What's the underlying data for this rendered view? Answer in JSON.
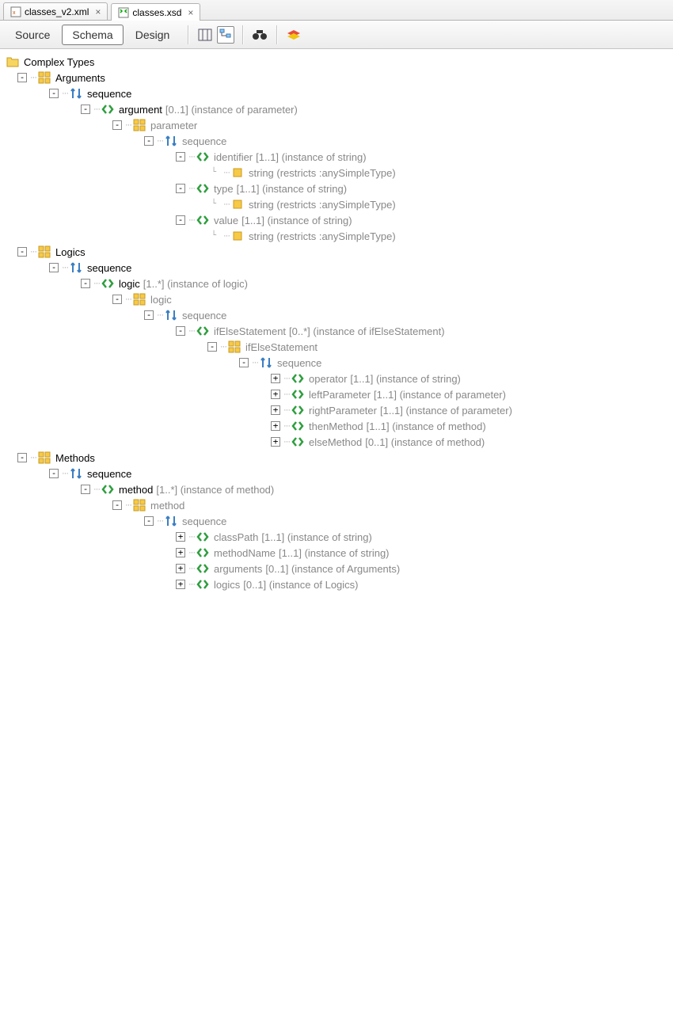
{
  "tabs": [
    {
      "label": "classes_v2.xml",
      "active": false
    },
    {
      "label": "classes.xsd",
      "active": true
    }
  ],
  "modes": [
    {
      "label": "Source",
      "active": false
    },
    {
      "label": "Schema",
      "active": true
    },
    {
      "label": "Design",
      "active": false
    }
  ],
  "root": {
    "label": "Complex Types"
  },
  "tree": [
    {
      "depth": 0,
      "exp": "-",
      "icon": "complex-type",
      "label": "Arguments",
      "bold": true
    },
    {
      "depth": 1,
      "exp": "-",
      "icon": "sequence",
      "label": "sequence",
      "bold": true
    },
    {
      "depth": 2,
      "exp": "-",
      "icon": "element",
      "label": "argument",
      "bold": true,
      "details": " [0..1] (instance of parameter)"
    },
    {
      "depth": 3,
      "exp": "-",
      "icon": "complex-type",
      "label": "parameter",
      "gray": true
    },
    {
      "depth": 4,
      "exp": "-",
      "icon": "sequence",
      "label": "sequence",
      "gray": true
    },
    {
      "depth": 5,
      "exp": "-",
      "icon": "element",
      "label": "identifier",
      "gray": true,
      "details": " [1..1] (instance of string)"
    },
    {
      "depth": 6,
      "exp": "",
      "icon": "simple-type",
      "label": "string (restricts :anySimpleType)",
      "gray": true,
      "last": true
    },
    {
      "depth": 5,
      "exp": "-",
      "icon": "element",
      "label": "type",
      "gray": true,
      "details": " [1..1] (instance of string)"
    },
    {
      "depth": 6,
      "exp": "",
      "icon": "simple-type",
      "label": "string (restricts :anySimpleType)",
      "gray": true,
      "last": true
    },
    {
      "depth": 5,
      "exp": "-",
      "icon": "element",
      "label": "value",
      "gray": true,
      "details": " [1..1] (instance of string)"
    },
    {
      "depth": 6,
      "exp": "",
      "icon": "simple-type",
      "label": "string (restricts :anySimpleType)",
      "gray": true,
      "last": true
    },
    {
      "depth": 0,
      "exp": "-",
      "icon": "complex-type",
      "label": "Logics",
      "bold": true
    },
    {
      "depth": 1,
      "exp": "-",
      "icon": "sequence",
      "label": "sequence",
      "bold": true
    },
    {
      "depth": 2,
      "exp": "-",
      "icon": "element",
      "label": "logic",
      "bold": true,
      "details": " [1..*] (instance of logic)"
    },
    {
      "depth": 3,
      "exp": "-",
      "icon": "complex-type",
      "label": "logic",
      "gray": true
    },
    {
      "depth": 4,
      "exp": "-",
      "icon": "sequence",
      "label": "sequence",
      "gray": true
    },
    {
      "depth": 5,
      "exp": "-",
      "icon": "element",
      "label": "ifElseStatement",
      "gray": true,
      "details": " [0..*] (instance of ifElseStatement)"
    },
    {
      "depth": 6,
      "exp": "-",
      "icon": "complex-type",
      "label": "ifElseStatement",
      "gray": true
    },
    {
      "depth": 7,
      "exp": "-",
      "icon": "sequence",
      "label": "sequence",
      "gray": true
    },
    {
      "depth": 8,
      "exp": "+",
      "icon": "element",
      "label": "operator",
      "gray": true,
      "details": " [1..1] (instance of string)"
    },
    {
      "depth": 8,
      "exp": "+",
      "icon": "element",
      "label": "leftParameter",
      "gray": true,
      "details": " [1..1] (instance of parameter)"
    },
    {
      "depth": 8,
      "exp": "+",
      "icon": "element",
      "label": "rightParameter",
      "gray": true,
      "details": " [1..1] (instance of parameter)"
    },
    {
      "depth": 8,
      "exp": "+",
      "icon": "element",
      "label": "thenMethod",
      "gray": true,
      "details": " [1..1] (instance of method)"
    },
    {
      "depth": 8,
      "exp": "+",
      "icon": "element",
      "label": "elseMethod",
      "gray": true,
      "details": " [0..1] (instance of method)"
    },
    {
      "depth": 0,
      "exp": "-",
      "icon": "complex-type",
      "label": "Methods",
      "bold": true
    },
    {
      "depth": 1,
      "exp": "-",
      "icon": "sequence",
      "label": "sequence",
      "bold": true
    },
    {
      "depth": 2,
      "exp": "-",
      "icon": "element",
      "label": "method",
      "bold": true,
      "details": " [1..*] (instance of method)"
    },
    {
      "depth": 3,
      "exp": "-",
      "icon": "complex-type",
      "label": "method",
      "gray": true
    },
    {
      "depth": 4,
      "exp": "-",
      "icon": "sequence",
      "label": "sequence",
      "gray": true
    },
    {
      "depth": 5,
      "exp": "+",
      "icon": "element",
      "label": "classPath",
      "gray": true,
      "details": " [1..1] (instance of string)"
    },
    {
      "depth": 5,
      "exp": "+",
      "icon": "element",
      "label": "methodName",
      "gray": true,
      "details": " [1..1] (instance of string)"
    },
    {
      "depth": 5,
      "exp": "+",
      "icon": "element",
      "label": "arguments",
      "gray": true,
      "details": " [0..1] (instance of Arguments)"
    },
    {
      "depth": 5,
      "exp": "+",
      "icon": "element",
      "label": "logics",
      "gray": true,
      "details": " [0..1] (instance of Logics)"
    }
  ]
}
